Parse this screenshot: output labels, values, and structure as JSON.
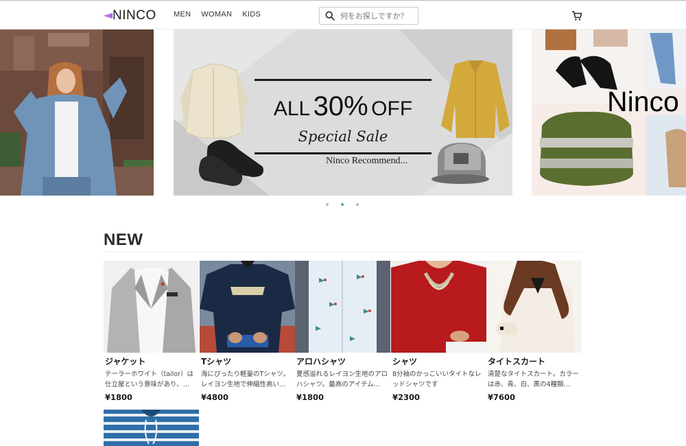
{
  "header": {
    "logo": "NINCO",
    "nav": [
      "MEN",
      "WOMAN",
      "KIDS"
    ],
    "search_placeholder": "何をお探しですか？"
  },
  "carousel": {
    "sale_main": "ALL 30% OFF",
    "sale_all": "ALL",
    "sale_percent": "30%",
    "sale_off": "OFF",
    "sale_sub": "Special Sale",
    "sale_recommend": "Ninco Recommend...",
    "right_overlay": "Ninco",
    "dots": 3,
    "active_dot": 1
  },
  "new_section": {
    "title": "NEW",
    "products": [
      {
        "name": "ジャケット",
        "desc": "テーラーホワイト（tailor）は仕立屋という意味があり、…",
        "price": "¥1800"
      },
      {
        "name": "Tシャツ",
        "desc": "海にぴったり軽量のTシャツ。レイヨン生地で伸縮性高い…",
        "price": "¥4800"
      },
      {
        "name": "アロハシャツ",
        "desc": "夏感溢れるレイヨン生地のアロハシャツ。最高のアイテム…",
        "price": "¥1800"
      },
      {
        "name": "シャツ",
        "desc": "8分袖のかっこいいタイトなレッドシャツです",
        "price": "¥2300"
      },
      {
        "name": "タイトスカート",
        "desc": "清楚なタイトスカート。カラーは赤、青、白、黒の4種類…",
        "price": "¥7600"
      }
    ]
  },
  "colors": {
    "accent_dot": "#5aa69a",
    "logo_gradient": "#d67ae0"
  }
}
